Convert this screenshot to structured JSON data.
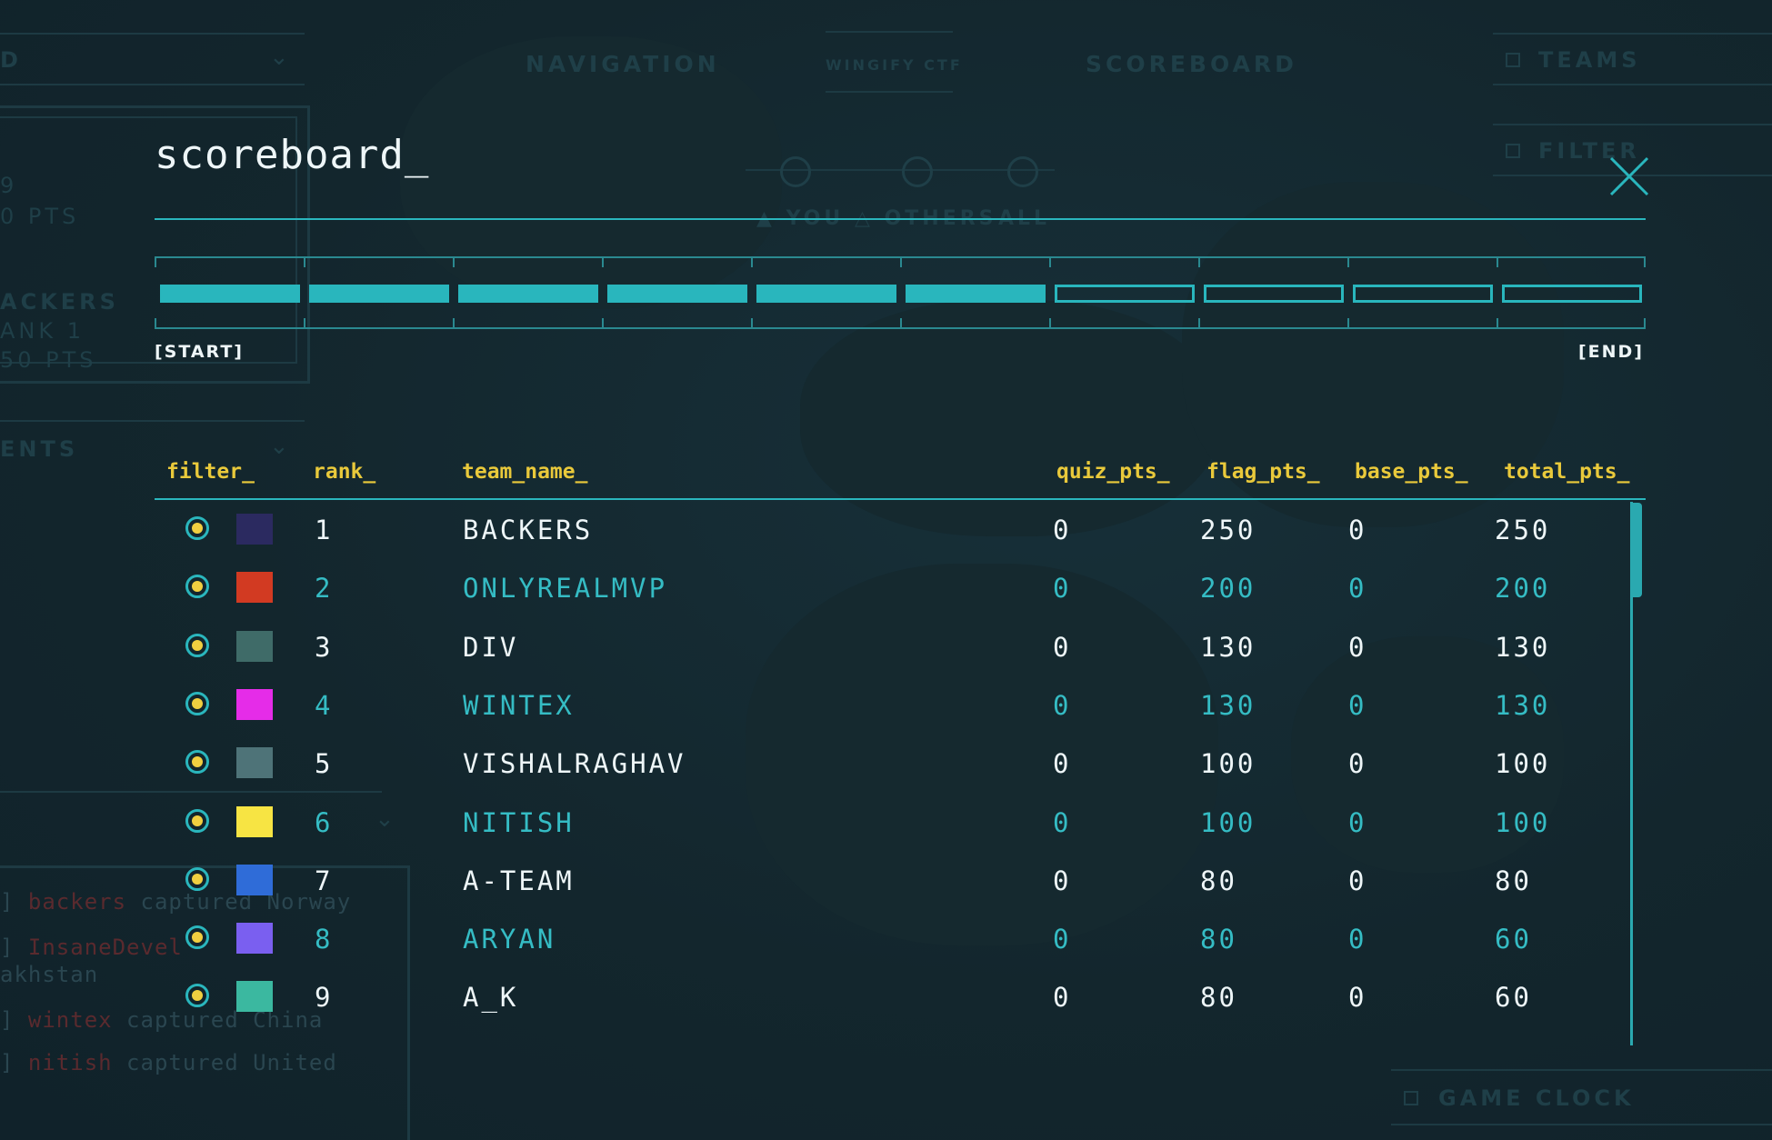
{
  "background": {
    "nav_tabs": [
      "NAVIGATION",
      "WINGIFY CTF",
      "SCOREBOARD"
    ],
    "nav_filters": [
      "▲ YOU",
      "△ OTHERS",
      "ALL"
    ],
    "right_panel": [
      "TEAMS",
      "FILTER"
    ],
    "game_clock_label": "GAME CLOCK",
    "left_panel": {
      "top_dropdown": "D",
      "card_line1": "9",
      "card_line2": "0 PTS",
      "team_line1": "ACKERS",
      "team_line2": "ANK 1",
      "team_line3": "50 PTS",
      "events_dropdown": "ENTS"
    },
    "log": [
      {
        "prefix": "] ",
        "team": "backers",
        "text": " captured Norway"
      },
      {
        "prefix": "] ",
        "team": "InsaneDevel",
        "text": ""
      },
      {
        "prefix": "akhstan",
        "team": "",
        "text": ""
      },
      {
        "prefix": "] ",
        "team": "wintex",
        "text": " captured China"
      },
      {
        "prefix": "] ",
        "team": "nitish",
        "text": " captured United"
      }
    ]
  },
  "modal": {
    "title": "scoreboard_",
    "close_icon": "close-x-icon",
    "progress": {
      "start_label": "[START]",
      "end_label": "[END]",
      "segments_total": 10,
      "segments_filled": 6,
      "fill_color": "#29b6bd"
    },
    "columns": {
      "filter": "filter_",
      "rank": "rank_",
      "team_name": "team_name_",
      "quiz_pts": "quiz_pts_",
      "flag_pts": "flag_pts_",
      "base_pts": "base_pts_",
      "total_pts": "total_pts_"
    },
    "rows": [
      {
        "rank": "1",
        "team": "BACKERS",
        "quiz": "0",
        "flag": "250",
        "base": "0",
        "total": "250",
        "color": "#2b2a60"
      },
      {
        "rank": "2",
        "team": "ONLYREALMVP",
        "quiz": "0",
        "flag": "200",
        "base": "0",
        "total": "200",
        "color": "#d23a22"
      },
      {
        "rank": "3",
        "team": "DIV",
        "quiz": "0",
        "flag": "130",
        "base": "0",
        "total": "130",
        "color": "#3f6b68"
      },
      {
        "rank": "4",
        "team": "WINTEX",
        "quiz": "0",
        "flag": "130",
        "base": "0",
        "total": "130",
        "color": "#e52ce8"
      },
      {
        "rank": "5",
        "team": "VISHALRAGHAV",
        "quiz": "0",
        "flag": "100",
        "base": "0",
        "total": "100",
        "color": "#4e7378"
      },
      {
        "rank": "6",
        "team": "NITISH",
        "quiz": "0",
        "flag": "100",
        "base": "0",
        "total": "100",
        "color": "#f7e443"
      },
      {
        "rank": "7",
        "team": "A-TEAM",
        "quiz": "0",
        "flag": "80",
        "base": "0",
        "total": "80",
        "color": "#2f6cd8"
      },
      {
        "rank": "8",
        "team": "ARYAN",
        "quiz": "0",
        "flag": "80",
        "base": "0",
        "total": "60",
        "color": "#7a5ff0"
      },
      {
        "rank": "9",
        "team": "A_K",
        "quiz": "0",
        "flag": "80",
        "base": "0",
        "total": "60",
        "color": "#3bb8a0"
      }
    ],
    "colors": {
      "accent": "#2ab6bd",
      "header_text": "#e9c93b",
      "row_text_primary": "#eef6f8",
      "row_text_alternate": "#35bcc4",
      "radio_dot": "#f0cf40"
    }
  }
}
